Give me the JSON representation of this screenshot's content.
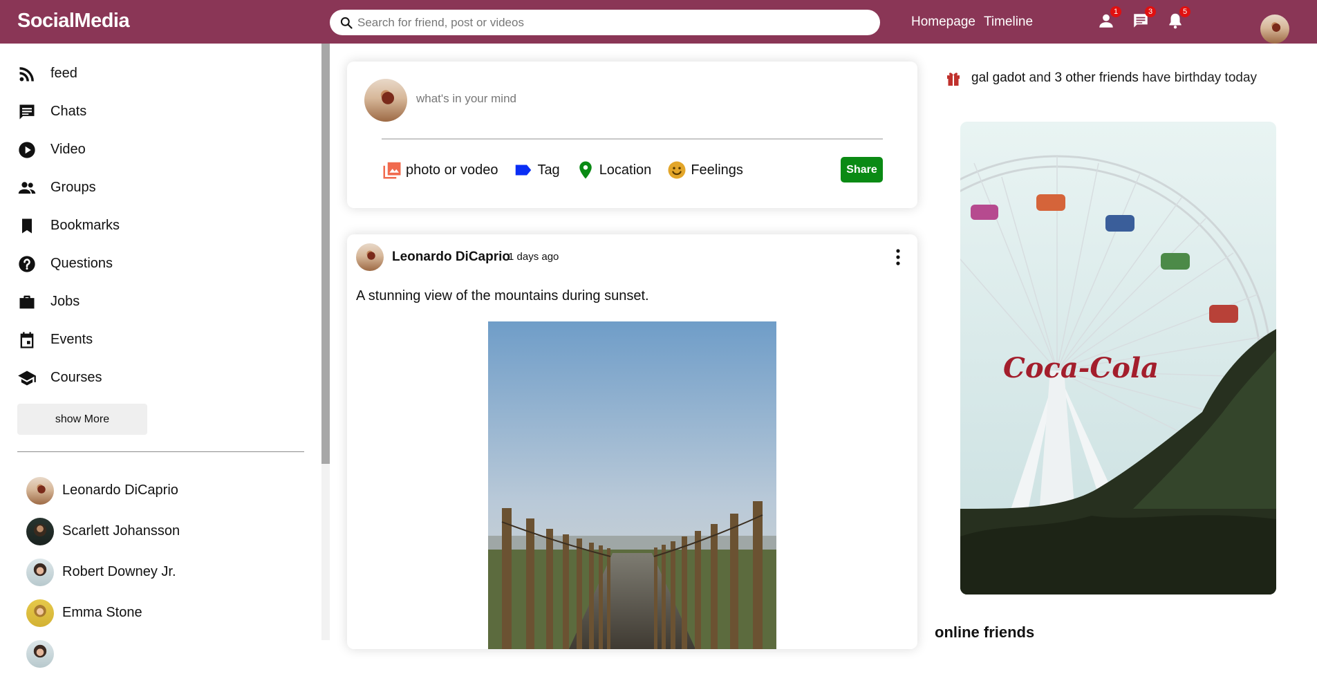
{
  "app": {
    "logo": "SocialMedia"
  },
  "search": {
    "placeholder": "Search for friend, post or videos"
  },
  "nav": {
    "links": [
      "Homepage",
      "Timeline"
    ]
  },
  "notifications": {
    "friends_count": "1",
    "messages_count": "3",
    "alerts_count": "5"
  },
  "sidebar": {
    "items": [
      {
        "label": "feed",
        "icon": "rss-icon"
      },
      {
        "label": "Chats",
        "icon": "chat-icon"
      },
      {
        "label": "Video",
        "icon": "play-circle-icon"
      },
      {
        "label": "Groups",
        "icon": "group-icon"
      },
      {
        "label": "Bookmarks",
        "icon": "bookmark-icon"
      },
      {
        "label": "Questions",
        "icon": "help-circle-icon"
      },
      {
        "label": "Jobs",
        "icon": "briefcase-icon"
      },
      {
        "label": "Events",
        "icon": "calendar-icon"
      },
      {
        "label": "Courses",
        "icon": "school-icon"
      }
    ],
    "show_more": "show More",
    "friends": [
      "Leonardo DiCaprio",
      "Scarlett Johansson",
      "Robert Downey Jr.",
      "Emma Stone"
    ]
  },
  "share": {
    "placeholder": "what's in your mind",
    "options": {
      "photo": "photo or vodeo",
      "tag": "Tag",
      "location": "Location",
      "feelings": "Feelings"
    },
    "button": "Share"
  },
  "post": {
    "author": "Leonardo DiCaprio",
    "time": "1 days ago",
    "text": "A stunning view of the mountains during sunset."
  },
  "rightbar": {
    "birthday": {
      "name": "gal gadot",
      "connector": "and",
      "others": "3 other friends",
      "suffix": "have birthday today"
    },
    "ad_logo_text": "Coca-Cola",
    "online_title": "online friends"
  },
  "colors": {
    "topbar": "#8a3656",
    "share_button": "#0a8a14",
    "badge": "#e01010"
  }
}
